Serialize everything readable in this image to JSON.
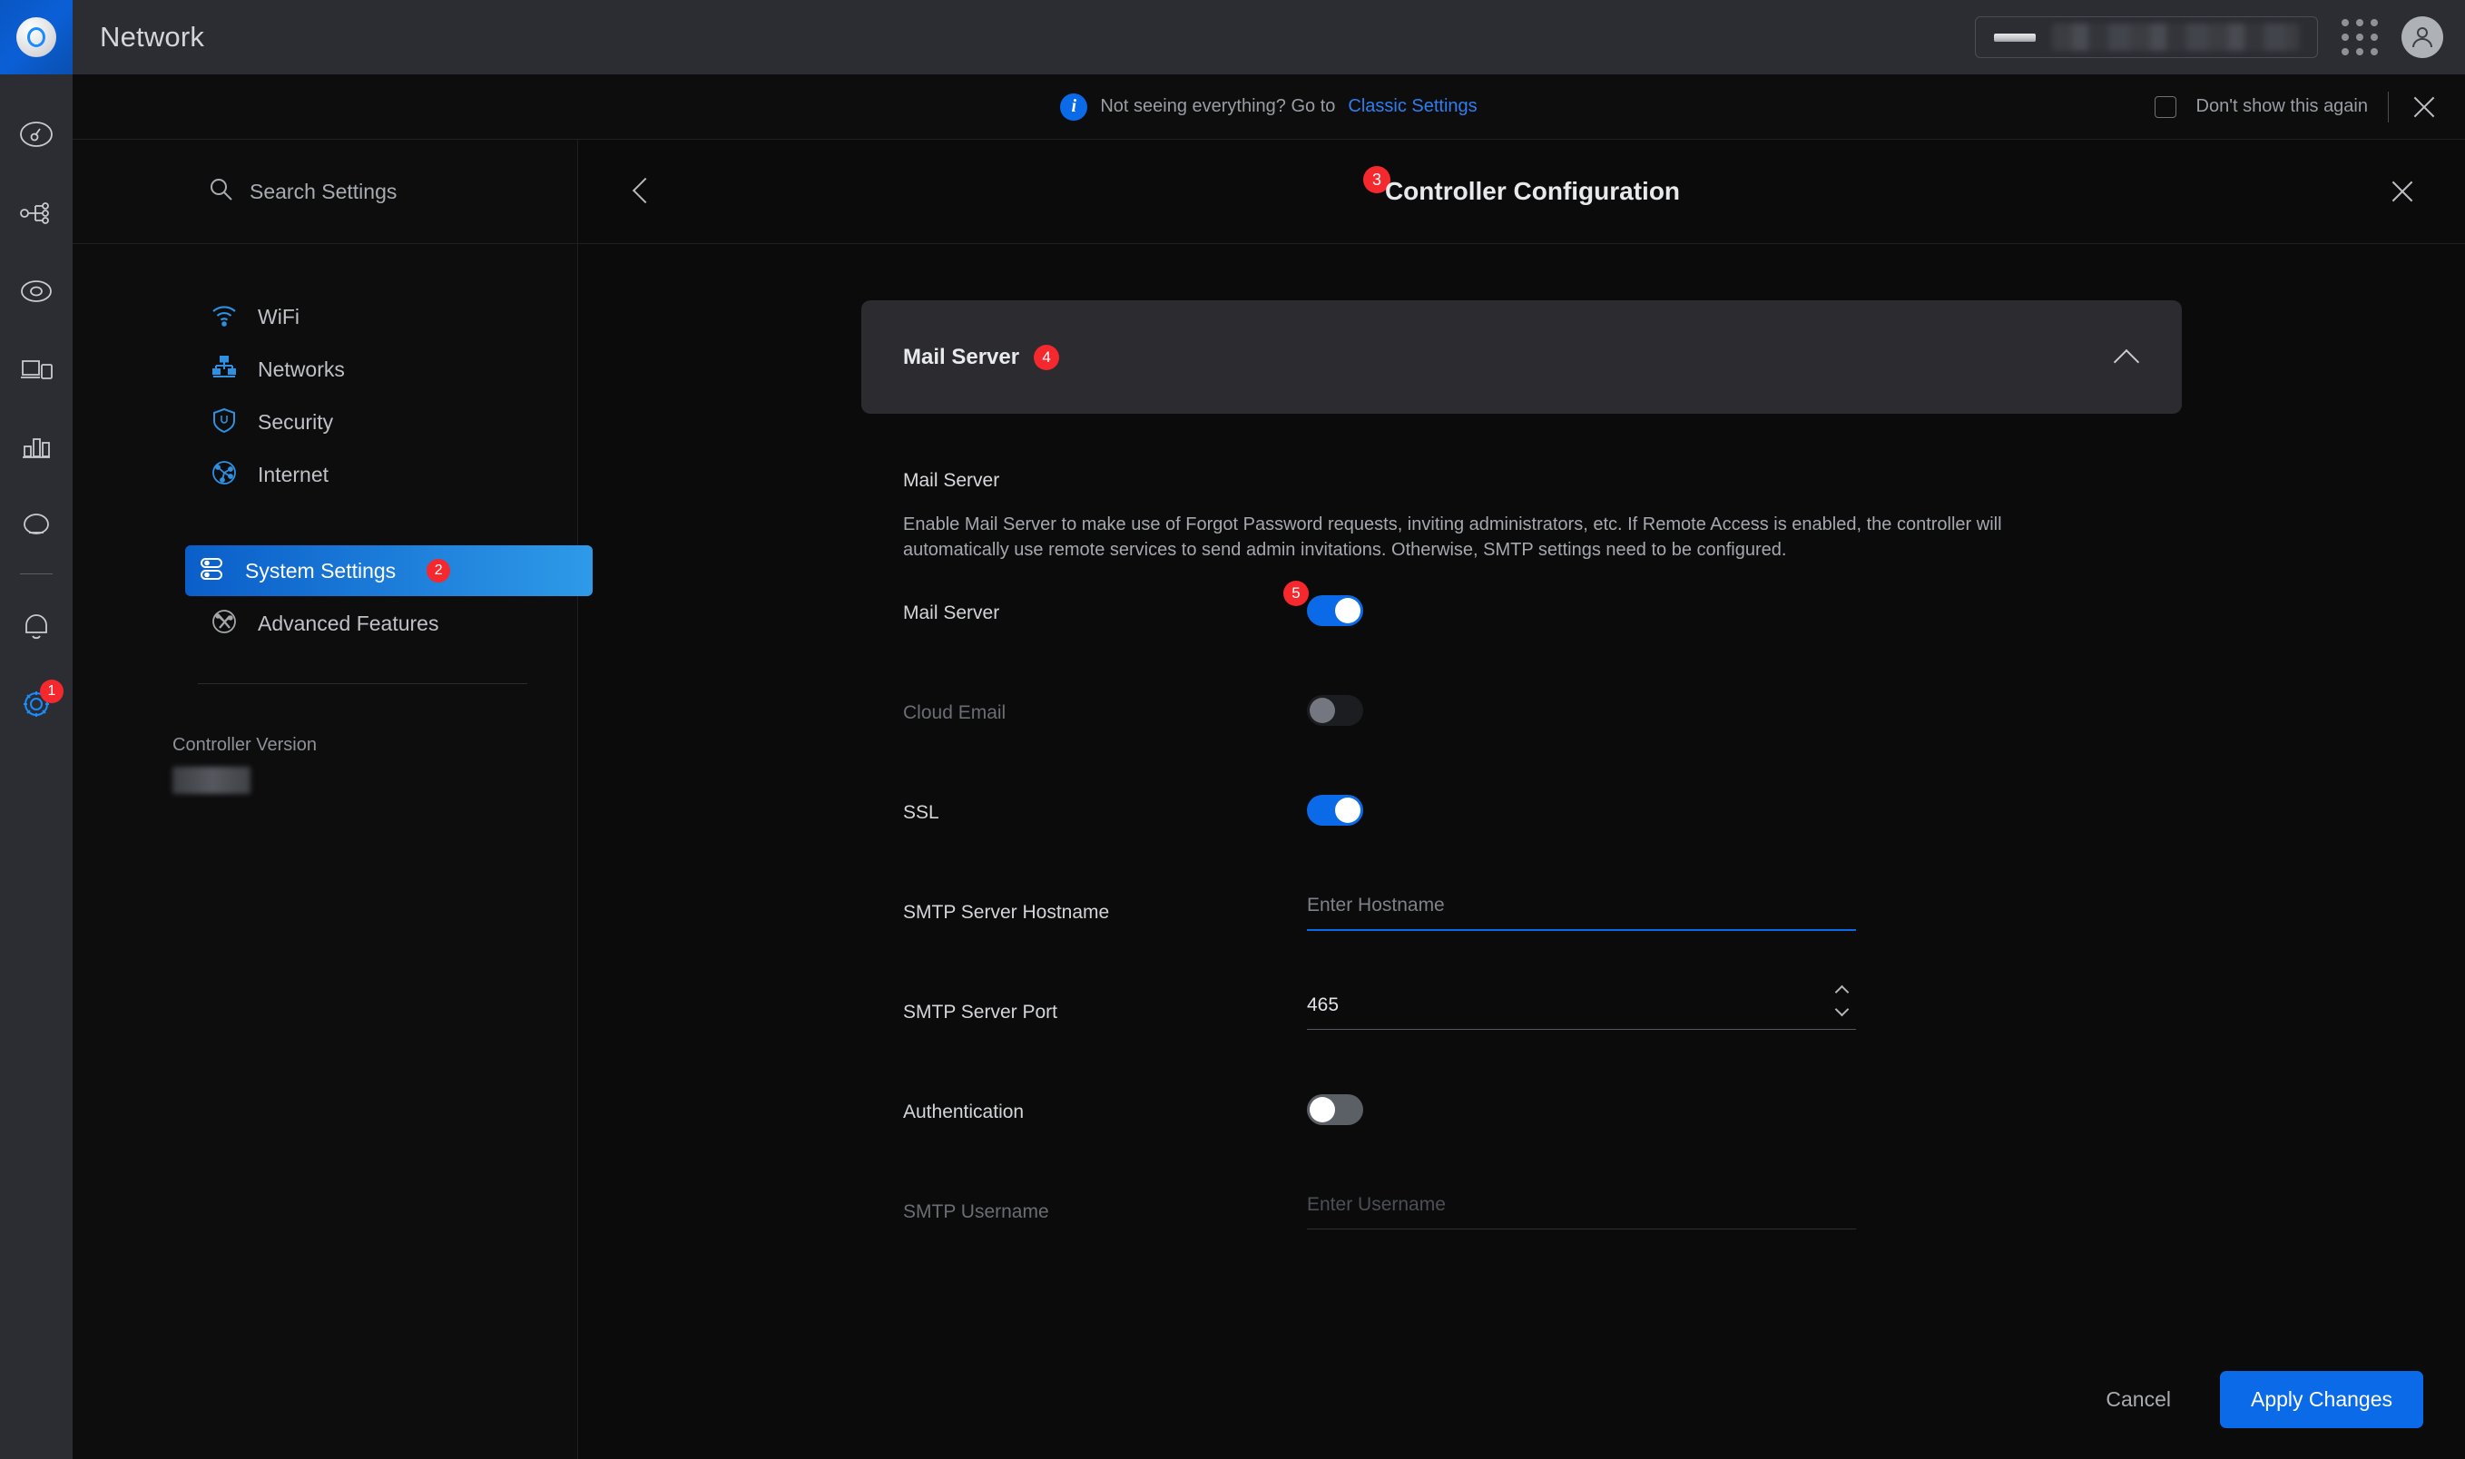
{
  "app": {
    "title": "Network",
    "logo_icon": "unifi-logo-icon"
  },
  "rail": {
    "items": [
      {
        "icon": "dashboard-speedometer-icon",
        "badge": ""
      },
      {
        "icon": "topology-icon",
        "badge": ""
      },
      {
        "icon": "wifi-access-point-icon",
        "badge": ""
      },
      {
        "icon": "client-devices-icon",
        "badge": ""
      },
      {
        "icon": "statistics-bar-chart-icon",
        "badge": ""
      },
      {
        "icon": "insights-shield-icon",
        "badge": ""
      }
    ],
    "bottom_items": [
      {
        "icon": "bell-notifications-icon",
        "badge": ""
      },
      {
        "icon": "gear-settings-icon",
        "badge": "1"
      }
    ]
  },
  "topbar": {
    "site_device_icon": "device-icon",
    "site_name_redacted": true,
    "apps_grid_icon": "apps-grid-icon",
    "avatar_icon": "user-avatar-icon"
  },
  "notice": {
    "info_icon": "info-circle-icon",
    "text": "Not seeing everything? Go to",
    "link": "Classic Settings",
    "dont_show_label": "Don't show this again",
    "checkbox_checked": false,
    "close_icon": "close-icon"
  },
  "settings_nav": {
    "search": {
      "icon": "search-icon",
      "placeholder": "Search Settings",
      "value": ""
    },
    "items": [
      {
        "label": "WiFi",
        "icon": "wifi-icon",
        "badge": "",
        "active": false
      },
      {
        "label": "Networks",
        "icon": "networks-icon",
        "badge": "",
        "active": false
      },
      {
        "label": "Security",
        "icon": "security-shield-icon",
        "badge": "",
        "active": false
      },
      {
        "label": "Internet",
        "icon": "internet-globe-icon",
        "badge": "",
        "active": false
      }
    ],
    "items2": [
      {
        "label": "System Settings",
        "icon": "system-settings-icon",
        "badge": "2",
        "active": true
      },
      {
        "label": "Advanced Features",
        "icon": "advanced-features-icon",
        "badge": "",
        "active": false
      }
    ],
    "version": {
      "label": "Controller Version",
      "value_redacted": true
    }
  },
  "detail": {
    "back_icon": "back-chevron-icon",
    "title": "Controller Configuration",
    "title_badge": "3",
    "close_icon": "close-icon",
    "card": {
      "title": "Mail Server",
      "badge": "4",
      "collapse_icon": "chevron-up-icon",
      "expanded": true
    },
    "section": {
      "title": "Mail Server",
      "description": "Enable Mail Server to make use of Forgot Password requests, inviting administrators, etc. If Remote Access is enabled, the controller will automatically use remote services to send admin invitations. Otherwise, SMTP settings need to be configured."
    },
    "fields": {
      "mail_server": {
        "label": "Mail Server",
        "state": "on",
        "badge": "5"
      },
      "cloud_email": {
        "label": "Cloud Email",
        "state": "disabled",
        "badge": ""
      },
      "ssl": {
        "label": "SSL",
        "state": "on",
        "badge": ""
      },
      "smtp_hostname": {
        "label": "SMTP Server Hostname",
        "placeholder": "Enter Hostname",
        "value": "",
        "focused": true
      },
      "smtp_port": {
        "label": "SMTP Server Port",
        "value": "465",
        "stepper_icon": "stepper-updown-icon"
      },
      "authentication": {
        "label": "Authentication",
        "state": "off",
        "badge": ""
      },
      "smtp_username": {
        "label": "SMTP Username",
        "placeholder": "Enter Username",
        "value": "",
        "disabled": true
      }
    },
    "footer": {
      "cancel_label": "Cancel",
      "apply_label": "Apply Changes"
    }
  },
  "colors": {
    "accent_blue": "#0b6ae8",
    "badge_red": "#f5282d",
    "rail_bg": "#2b2d33",
    "page_bg": "#0b0b0c",
    "card_bg": "#2b2b30"
  }
}
